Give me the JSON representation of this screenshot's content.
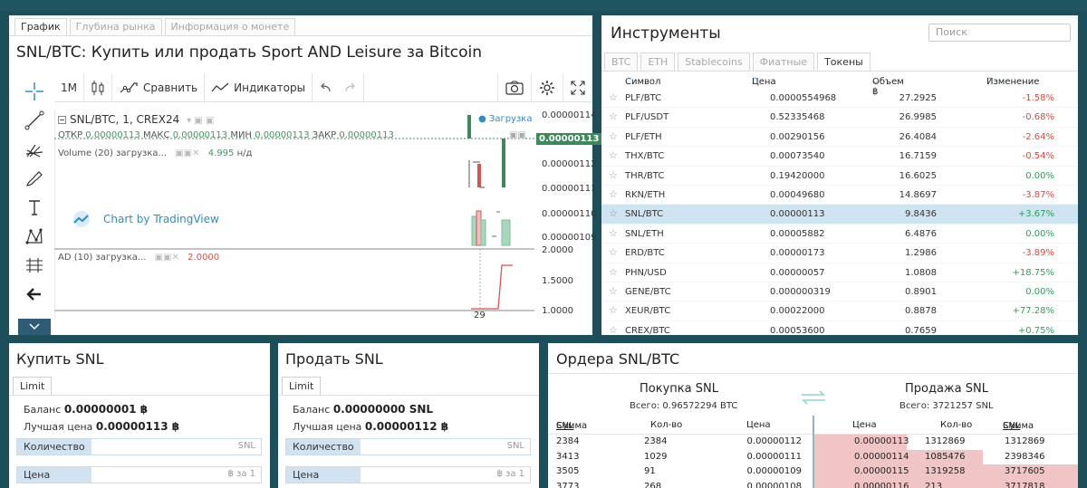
{
  "chart_panel": {
    "tabs": [
      {
        "label": "График",
        "active": true
      },
      {
        "label": "Глубина рынка",
        "active": false
      },
      {
        "label": "Информация о монете",
        "active": false
      }
    ],
    "title": "SNL/BTC: Купить или продать Sport AND Leisure за Bitcoin",
    "toolbar": {
      "interval": "1M",
      "compare": "Сравнить",
      "indicators": "Индикаторы"
    },
    "legend": {
      "symbol": "SNL/BTC, 1, CREX24",
      "open_label": "ОТКР",
      "open": "0.00000113",
      "high_label": "МАКС",
      "high": "0.00000113",
      "low_label": "МИН",
      "low": "0.00000113",
      "close_label": "ЗАКР",
      "close": "0.00000113",
      "volume": "Volume (20) загрузка...",
      "volume_value": "4.995",
      "volume_unit": "н/д",
      "loading": "Загрузка",
      "ad": "AD (10) загрузка...",
      "ad_value": "2.0000"
    },
    "price_axis": [
      "0.00000114",
      "0.00000112",
      "0.00000111",
      "0.00000110",
      "0.00000109"
    ],
    "current_price": "0.00000113",
    "ad_axis": [
      "2.0000",
      "1.5000",
      "1.0000"
    ],
    "time_label": "29",
    "tv_logo": "Chart by TradingView",
    "colors": {
      "up": "#3c8a5b",
      "down": "#d9534f",
      "accent": "#2a8fc9"
    }
  },
  "instruments": {
    "title": "Инструменты",
    "search_placeholder": "Поиск",
    "tabs": [
      {
        "label": "BTC",
        "active": false
      },
      {
        "label": "ETH",
        "active": false
      },
      {
        "label": "Stablecoins",
        "active": false
      },
      {
        "label": "Фиатные",
        "active": false
      },
      {
        "label": "Токены",
        "active": true
      }
    ],
    "headers": {
      "symbol": "Символ",
      "price": "Цена",
      "volume": "Объем ฿",
      "change": "Изменение"
    },
    "rows": [
      {
        "symbol": "PLF/BTC",
        "price": "0.0000554968",
        "volume": "27.2925",
        "change": "-1.58%",
        "dir": "neg"
      },
      {
        "symbol": "PLF/USDT",
        "price": "0.52335468",
        "volume": "26.9985",
        "change": "-0.68%",
        "dir": "neg"
      },
      {
        "symbol": "PLF/ETH",
        "price": "0.00290156",
        "volume": "26.4084",
        "change": "-2.64%",
        "dir": "neg"
      },
      {
        "symbol": "THX/BTC",
        "price": "0.00073540",
        "volume": "16.7159",
        "change": "-0.54%",
        "dir": "neg"
      },
      {
        "symbol": "THR/BTC",
        "price": "0.19420000",
        "volume": "16.6025",
        "change": "0.00%",
        "dir": "zero"
      },
      {
        "symbol": "RKN/ETH",
        "price": "0.00049680",
        "volume": "14.8697",
        "change": "-3.87%",
        "dir": "neg"
      },
      {
        "symbol": "SNL/BTC",
        "price": "0.00000113",
        "volume": "9.8436",
        "change": "+3.67%",
        "dir": "pos",
        "selected": true
      },
      {
        "symbol": "SNL/ETH",
        "price": "0.00005882",
        "volume": "6.4876",
        "change": "0.00%",
        "dir": "zero"
      },
      {
        "symbol": "ERD/BTC",
        "price": "0.00000173",
        "volume": "1.2986",
        "change": "-3.89%",
        "dir": "neg"
      },
      {
        "symbol": "PHN/USD",
        "price": "0.00000057",
        "volume": "1.0808",
        "change": "+18.75%",
        "dir": "pos"
      },
      {
        "symbol": "GENE/BTC",
        "price": "0.000000319",
        "volume": "0.8901",
        "change": "0.00%",
        "dir": "zero"
      },
      {
        "symbol": "XEUR/BTC",
        "price": "0.00022000",
        "volume": "0.8878",
        "change": "+77.28%",
        "dir": "pos"
      },
      {
        "symbol": "CREX/BTC",
        "price": "0.00053600",
        "volume": "0.7659",
        "change": "+0.75%",
        "dir": "pos"
      }
    ]
  },
  "buy": {
    "title": "Купить SNL",
    "tab": "Limit",
    "balance_label": "Баланс",
    "balance": "0.00000001 ฿",
    "best_label": "Лучшая цена",
    "best": "0.00000113 ฿",
    "qty_label": "Количество",
    "qty_unit": "SNL",
    "price_label": "Цена",
    "price_unit": "฿ за 1"
  },
  "sell": {
    "title": "Продать SNL",
    "tab": "Limit",
    "balance_label": "Баланс",
    "balance": "0.00000000 SNL",
    "best_label": "Лучшая цена",
    "best": "0.00000112 ฿",
    "qty_label": "Количество",
    "qty_unit": "SNL",
    "price_label": "Цена",
    "price_unit": "฿ за 1"
  },
  "orders": {
    "title": "Ордера SNL/BTC",
    "buy_title": "Покупка SNL",
    "buy_total": "Всего: 0.96572294 BTC",
    "sell_title": "Продажа SNL",
    "sell_total": "Всего: 3721257 SNL",
    "bid_cols": {
      "sum": "Сумма",
      "sum_unit": "SNL",
      "qty": "Кол-во",
      "price": "Цена"
    },
    "ask_cols": {
      "price": "Цена",
      "qty": "Кол-во",
      "sum": "Сумма",
      "sum_unit": "SNL"
    },
    "bids": [
      {
        "sum": "2384",
        "qty": "2384",
        "price": "0.00000112"
      },
      {
        "sum": "3413",
        "qty": "1029",
        "price": "0.00000111"
      },
      {
        "sum": "3505",
        "qty": "91",
        "price": "0.00000109"
      },
      {
        "sum": "3773",
        "qty": "268",
        "price": "0.00000108"
      }
    ],
    "asks": [
      {
        "price": "0.00000113",
        "qty": "1312869",
        "sum": "1312869",
        "depth": 0.35
      },
      {
        "price": "0.00000114",
        "qty": "1085476",
        "sum": "2398346",
        "depth": 0.64
      },
      {
        "price": "0.00000115",
        "qty": "1319258",
        "sum": "3717605",
        "depth": 1.0
      },
      {
        "price": "0.00000116",
        "qty": "213",
        "sum": "3717818",
        "depth": 1.0
      }
    ]
  }
}
